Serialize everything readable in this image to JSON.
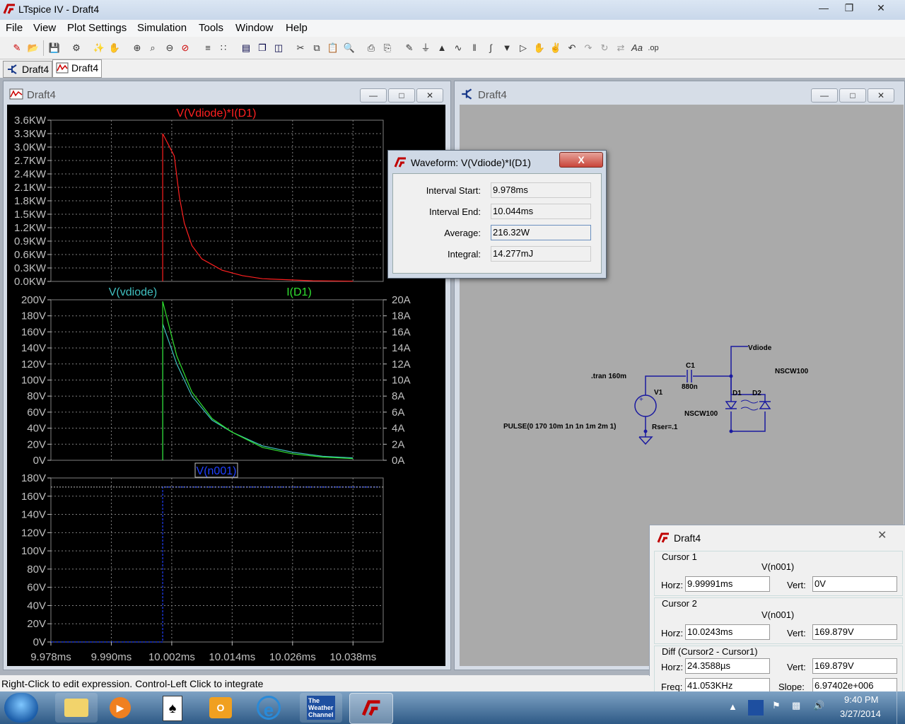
{
  "window": {
    "title": "LTspice IV - Draft4"
  },
  "menu": [
    "File",
    "View",
    "Plot Settings",
    "Simulation",
    "Tools",
    "Window",
    "Help"
  ],
  "tabs": [
    {
      "label": "Draft4"
    },
    {
      "label": "Draft4"
    }
  ],
  "plot_window": {
    "title": "Draft4"
  },
  "schematic_window": {
    "title": "Draft4"
  },
  "chart_data": [
    {
      "type": "line",
      "title": "V(Vdiode)*I(D1)",
      "yticks": [
        "3.6KW",
        "3.3KW",
        "3.0KW",
        "2.7KW",
        "2.4KW",
        "2.1KW",
        "1.8KW",
        "1.5KW",
        "1.2KW",
        "0.9KW",
        "0.6KW",
        "0.3KW",
        "0.0KW"
      ],
      "ylim": [
        0,
        3600
      ],
      "series": [
        {
          "name": "V(Vdiode)*I(D1)",
          "color": "#ff2020",
          "x": [
            10.0002,
            10.0002,
            10.0025,
            10.0035,
            10.0045,
            10.006,
            10.008,
            10.012,
            10.016,
            10.02,
            10.03,
            10.038
          ],
          "y": [
            0,
            3300,
            2800,
            1900,
            1300,
            800,
            500,
            250,
            130,
            60,
            15,
            5
          ]
        }
      ]
    },
    {
      "type": "line",
      "series_labels": [
        "V(vdiode)",
        "I(D1)"
      ],
      "yticks_left": [
        "200V",
        "180V",
        "160V",
        "140V",
        "120V",
        "100V",
        "80V",
        "60V",
        "40V",
        "20V",
        "0V"
      ],
      "yticks_right": [
        "20A",
        "18A",
        "16A",
        "14A",
        "12A",
        "10A",
        "8A",
        "6A",
        "4A",
        "2A",
        "0A"
      ],
      "ylim": [
        0,
        200
      ],
      "series": [
        {
          "name": "V(vdiode)",
          "color": "#40c0c0",
          "x": [
            10.0002,
            10.0002,
            10.003,
            10.006,
            10.01,
            10.014,
            10.02,
            10.026,
            10.032,
            10.038
          ],
          "y": [
            0,
            170,
            120,
            80,
            50,
            35,
            18,
            10,
            5,
            3
          ]
        },
        {
          "name": "I(D1)",
          "color": "#30e030",
          "x": [
            10.0002,
            10.0002,
            10.003,
            10.006,
            10.01,
            10.014,
            10.02,
            10.026,
            10.032,
            10.038
          ],
          "y": [
            0,
            198,
            130,
            85,
            52,
            35,
            16,
            8,
            4,
            2
          ]
        }
      ]
    },
    {
      "type": "line",
      "series_labels": [
        "V(n001)"
      ],
      "yticks": [
        "180V",
        "160V",
        "140V",
        "120V",
        "100V",
        "80V",
        "60V",
        "40V",
        "20V",
        "0V"
      ],
      "xticks": [
        "9.978ms",
        "9.990ms",
        "10.002ms",
        "10.014ms",
        "10.026ms",
        "10.038ms"
      ],
      "ylim": [
        0,
        180
      ],
      "series": [
        {
          "name": "V(n001)",
          "color": "#2040ff",
          "x": [
            9.978,
            10.0002,
            10.0002,
            10.043
          ],
          "y": [
            0,
            0,
            170,
            170
          ]
        }
      ]
    }
  ],
  "waveform_dialog": {
    "title": "Waveform: V(Vdiode)*I(D1)",
    "close": "X",
    "rows": [
      {
        "label": "Interval Start:",
        "value": "9.978ms"
      },
      {
        "label": "Interval End:",
        "value": "10.044ms"
      },
      {
        "label": "Average:",
        "value": "216.32W"
      },
      {
        "label": "Integral:",
        "value": "14.277mJ"
      }
    ]
  },
  "schematic": {
    "tran": ".tran 160m",
    "c1": "C1",
    "c1_val": "880n",
    "v1": "V1",
    "d1": "D1",
    "d2": "D2",
    "vdiode": "Vdiode",
    "nscw_right": "NSCW100",
    "nscw_left": "NSCW100",
    "pulse": "PULSE(0 170 10m 1n 1n 1m 2m 1)",
    "rser": "Rser=.1"
  },
  "cursor_panel": {
    "title": "Draft4",
    "cursor1": {
      "label": "Cursor 1",
      "trace": "V(n001)",
      "horz_label": "Horz:",
      "horz": "9.99991ms",
      "vert_label": "Vert:",
      "vert": "0V"
    },
    "cursor2": {
      "label": "Cursor 2",
      "trace": "V(n001)",
      "horz_label": "Horz:",
      "horz": "10.0243ms",
      "vert_label": "Vert:",
      "vert": "169.879V"
    },
    "diff": {
      "label": "Diff (Cursor2 - Cursor1)",
      "horz_label": "Horz:",
      "horz": "24.3588µs",
      "vert_label": "Vert:",
      "vert": "169.879V",
      "freq_label": "Freq:",
      "freq": "41.053KHz",
      "slope_label": "Slope:",
      "slope": "6.97402e+006"
    }
  },
  "status_bar": "Right-Click to edit expression. Control-Left Click to integrate",
  "taskbar": {
    "weather": "The Weather Channel",
    "time": "9:40 PM",
    "date": "3/27/2014"
  }
}
